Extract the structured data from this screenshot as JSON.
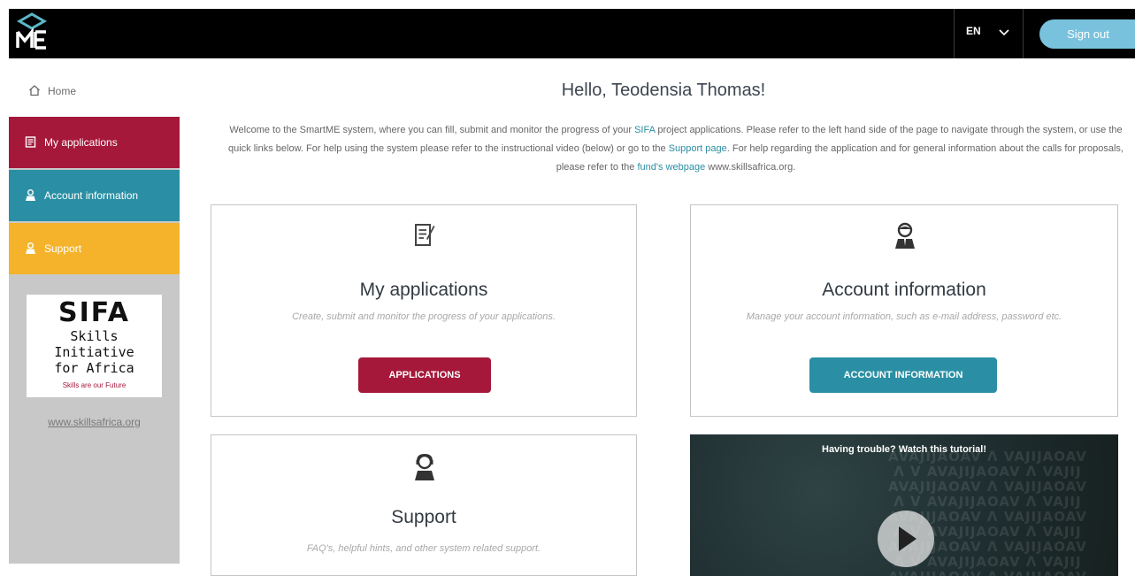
{
  "header": {
    "logo_icon": "smartme-logo-icon",
    "language": "EN",
    "language_icon": "chevron-down-icon",
    "sign_out_label": "Sign out",
    "colors": {
      "bar": "#000000",
      "sign_out": "#79c2dd"
    }
  },
  "sidebar": {
    "home_label": "Home",
    "home_icon": "home-icon",
    "items": [
      {
        "label": "My applications",
        "icon": "document-icon",
        "color": "#a5183a"
      },
      {
        "label": "Account information",
        "icon": "user-icon",
        "color": "#2a8fa4"
      },
      {
        "label": "Support",
        "icon": "support-icon",
        "color": "#f4b32a"
      }
    ],
    "partner_logo": {
      "name": "SIFA",
      "line1": "Skills Initiative",
      "line2": "for Africa",
      "tagline": "Skills are our Future"
    },
    "website_link": "www.skillsafrica.org"
  },
  "main": {
    "greeting": "Hello, Teodensia Thomas!",
    "intro": {
      "part1": "Welcome to the SmartME system, where you can fill, submit and monitor the progress of your ",
      "link_sifa": "SIFA",
      "part2": " project applications. Please refer to the left hand side of the page to navigate through the system, or use the quick links below. For help using the system please refer to the instructional video (below) or go to the ",
      "link_support": "Support page",
      "part3": ". For help regarding the application and for general information about the calls for proposals, please refer to the ",
      "link_fund": "fund's webpage",
      "part4": " www.skillsafrica.org."
    },
    "cards": {
      "applications": {
        "icon": "document-edit-icon",
        "title": "My applications",
        "description": "Create, submit and monitor the progress of your applications.",
        "button": "APPLICATIONS",
        "color": "#a5183a"
      },
      "account": {
        "icon": "user-icon",
        "title": "Account information",
        "description": "Manage your account information, such as e-mail address, password etc.",
        "button": "ACCOUNT INFORMATION",
        "color": "#2a8fa4"
      },
      "support": {
        "icon": "support-agent-icon",
        "title": "Support",
        "description": "FAQ's, helpful hints, and other system related support."
      }
    },
    "video": {
      "title": "Having trouble? Watch this tutorial!",
      "play_icon": "play-icon"
    }
  }
}
